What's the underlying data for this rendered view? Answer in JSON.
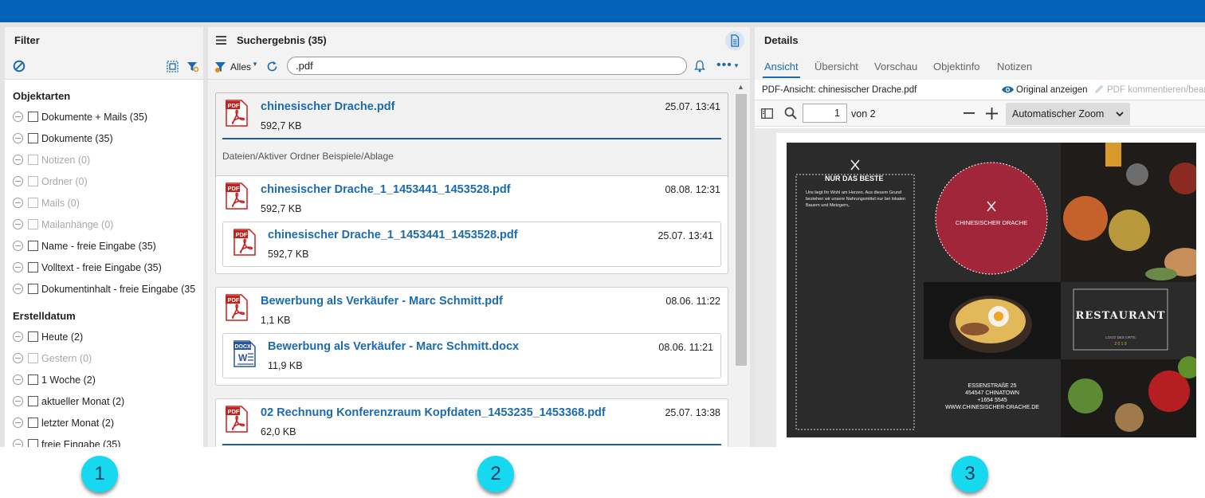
{
  "colors": {
    "accent": "#1b6bb0",
    "topbar": "#0463b8",
    "badge": "#16d9ef",
    "pdf_red": "#c8211b",
    "flyer_bg": "#2b2b2b",
    "flyer_circle": "#a2263a"
  },
  "filter": {
    "title": "Filter",
    "sections": [
      {
        "title": "Objektarten",
        "items": [
          {
            "label": "Dokumente + Mails (35)",
            "enabled": true
          },
          {
            "label": "Dokumente (35)",
            "enabled": true
          },
          {
            "label": "Notizen (0)",
            "enabled": false
          },
          {
            "label": "Ordner (0)",
            "enabled": false
          },
          {
            "label": "Mails (0)",
            "enabled": false
          },
          {
            "label": "Mailanhänge (0)",
            "enabled": false
          },
          {
            "label": "Name - freie Eingabe (35)",
            "enabled": true
          },
          {
            "label": "Volltext - freie Eingabe (35)",
            "enabled": true
          },
          {
            "label": "Dokumentinhalt - freie Eingabe (35",
            "enabled": true
          }
        ]
      },
      {
        "title": "Erstelldatum",
        "items": [
          {
            "label": "Heute (2)",
            "enabled": true
          },
          {
            "label": "Gestern (0)",
            "enabled": false
          },
          {
            "label": "1 Woche (2)",
            "enabled": true
          },
          {
            "label": "aktueller Monat (2)",
            "enabled": true
          },
          {
            "label": "letzter Monat (2)",
            "enabled": true
          },
          {
            "label": "freie Eingabe (35)",
            "enabled": true
          }
        ]
      }
    ]
  },
  "results": {
    "title": "Suchergebnis (35)",
    "scope_label": "Alles",
    "search_value": ".pdf",
    "items": [
      {
        "name": "chinesischer Drache.pdf",
        "date": "25.07. 13:41",
        "size": "592,7 KB",
        "path": [
          "Dateien",
          "Aktiver Ordner Beispiele",
          "Ablage"
        ]
      },
      {
        "name": "chinesischer Drache_1_1453441_1453528.pdf",
        "date": "08.08. 12:31",
        "size": "592,7 KB",
        "sub": {
          "name": "chinesischer Drache_1_1453441_1453528.pdf",
          "date": "25.07. 13:41",
          "size": "592,7 KB"
        }
      },
      {
        "name": "Bewerbung als Verkäufer - Marc Schmitt.pdf",
        "date": "08.06. 11:22",
        "size": "1,1 KB",
        "sub": {
          "name": "Bewerbung als Verkäufer - Marc Schmitt.docx",
          "date": "08.06. 11:21",
          "size": "11,9 KB"
        }
      },
      {
        "name": "02 Rechnung Konferenzraum Kopfdaten_1453235_1453368.pdf",
        "date": "25.07. 13:38",
        "size": "62,0 KB"
      }
    ]
  },
  "details": {
    "title": "Details",
    "tabs": [
      "Ansicht",
      "Übersicht",
      "Vorschau",
      "Objektinfo",
      "Notizen"
    ],
    "pdf_title": "PDF-Ansicht: chinesischer Drache.pdf",
    "original_label": "Original anzeigen",
    "annotate_label": "PDF kommentieren/bearbe",
    "page_value": "1",
    "page_of": "von 2",
    "zoom_label": "Automatischer Zoom",
    "flyer": {
      "heading": "NUR DAS BESTE",
      "body": "Uns liegt Ihr Wohl am Herzen. Aus diesem Grund beziehen wir unsere Nahrungsmittel nur bei lokalen Bauern und Metzgern,.",
      "circle_text": "CHINESISCHER DRACHE",
      "restaurant": "RESTAURANT",
      "restaurant_sub": "LOGO DES ORTS",
      "year": "2 0 1 9",
      "address": [
        "ESSENSTRAßE 25",
        "454547 CHINATOWN",
        "+1654 5545",
        "WWW.CHINESISCHER-DRACHE.DE"
      ]
    }
  },
  "badges": [
    "1",
    "2",
    "3"
  ]
}
